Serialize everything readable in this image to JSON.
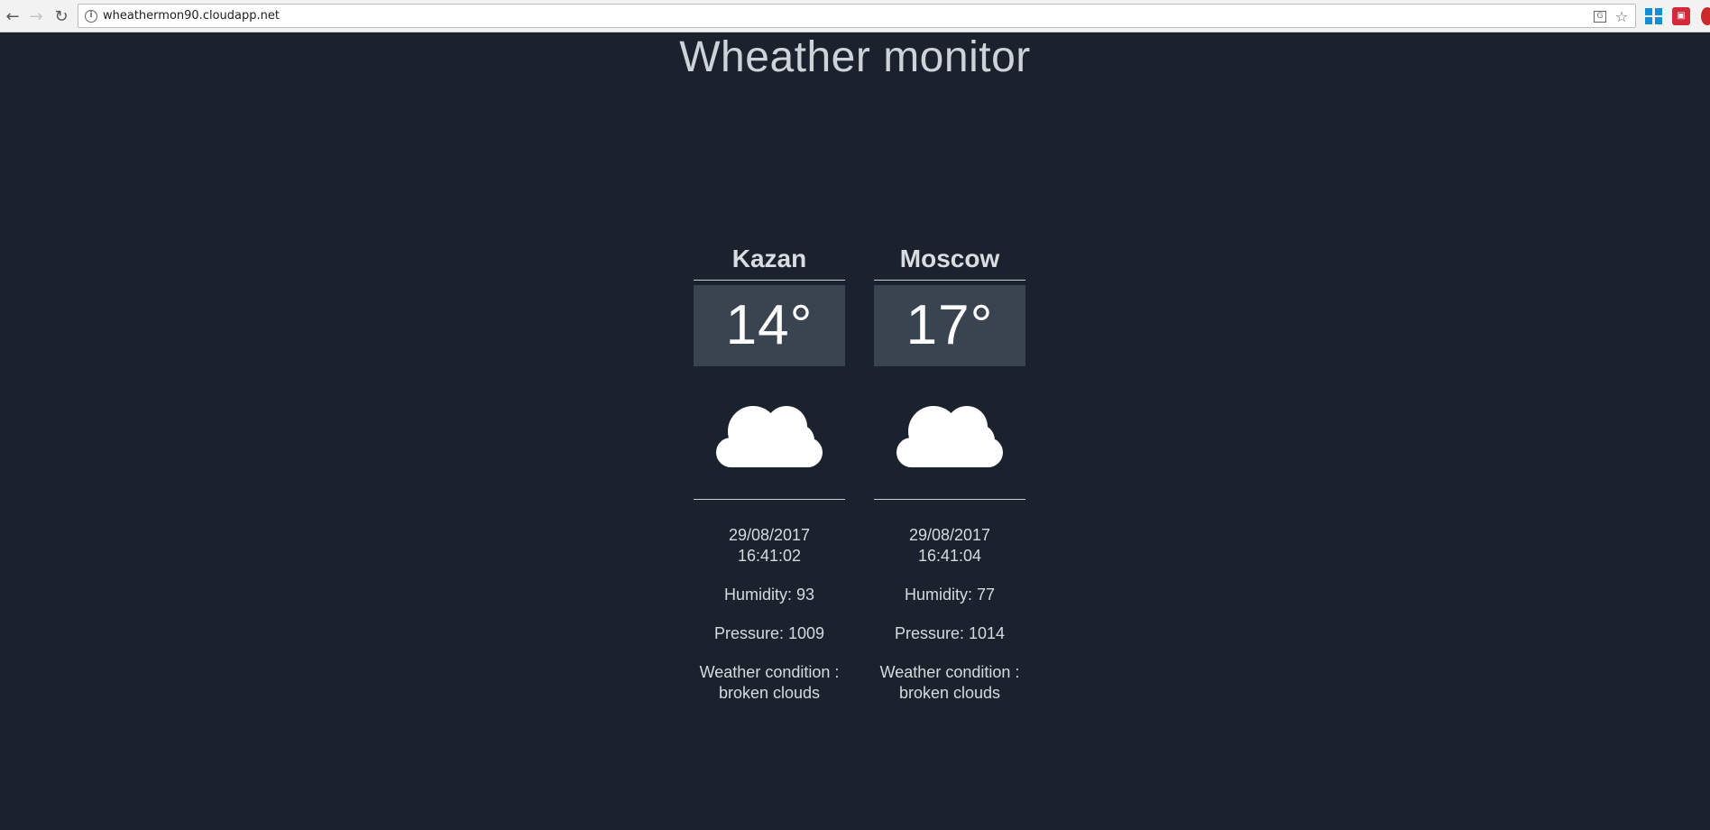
{
  "browser": {
    "url": "wheathermon90.cloudapp.net"
  },
  "page": {
    "title": "Wheather monitor"
  },
  "cities": [
    {
      "name": "Kazan",
      "temperature": "14°",
      "icon": "cloud-icon",
      "date": "29/08/2017",
      "time": "16:41:02",
      "humidity": "Humidity: 93",
      "pressure": "Pressure: 1009",
      "condition_label": "Weather condition :",
      "condition_value": "broken clouds"
    },
    {
      "name": "Moscow",
      "temperature": "17°",
      "icon": "cloud-icon",
      "date": "29/08/2017",
      "time": "16:41:04",
      "humidity": "Humidity: 77",
      "pressure": "Pressure: 1014",
      "condition_label": "Weather condition :",
      "condition_value": "broken clouds"
    }
  ],
  "colors": {
    "background": "#1a232d",
    "temp_box": "#3a4450",
    "text": "#d5dade"
  }
}
